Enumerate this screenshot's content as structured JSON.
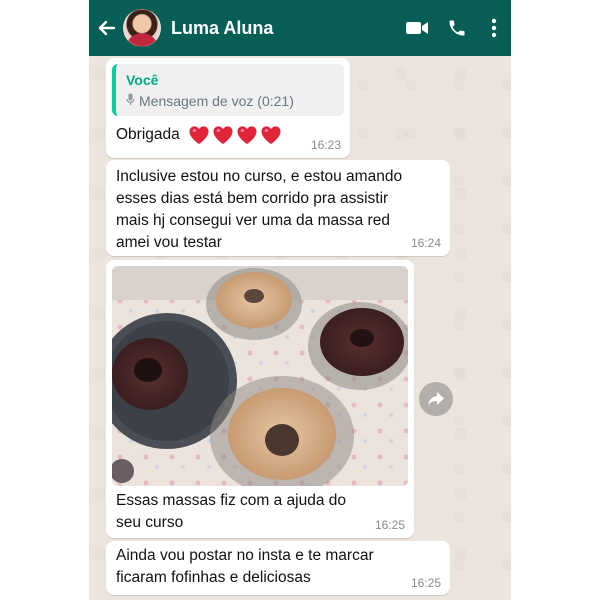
{
  "header": {
    "contact_name": "Luma Aluna",
    "back_icon": "arrow-left-icon",
    "video_icon": "video-camera-icon",
    "call_icon": "phone-icon",
    "menu_icon": "more-vertical-icon",
    "bar_color": "#075e54"
  },
  "messages": [
    {
      "quote_sender": "Você",
      "quote_text": "Mensagem de voz (0:21)",
      "text": "Obrigada",
      "hearts": 4,
      "time": "16:23"
    },
    {
      "line1": "Inclusive estou no curso, e estou amando",
      "line2": "esses dias está bem corrido pra assistir",
      "line3": "mais hj consegui ver uma da massa red",
      "line4": "amei vou testar",
      "time": "16:24"
    },
    {
      "media": "photo",
      "line1": "Essas massas fiz com a ajuda do",
      "line2": "seu curso",
      "time": "16:25"
    },
    {
      "line1": "Ainda vou postar no insta e te marcar",
      "line2": "ficaram fofinhas e deliciosas",
      "time": "16:25"
    }
  ],
  "forward_icon": "forward-arrow-icon",
  "colors": {
    "chat_background": "#ece5dd",
    "bubble": "#ffffff",
    "quote_accent": "#06cf9c",
    "heart": "#e0243a"
  }
}
